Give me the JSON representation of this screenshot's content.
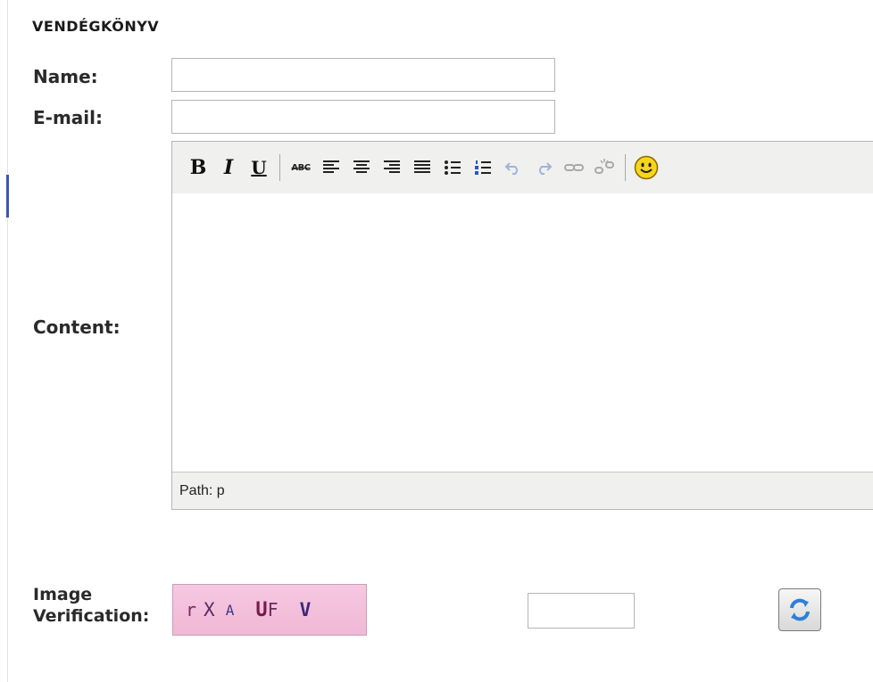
{
  "form": {
    "title": "VENDÉGKÖNYV",
    "name_label": "Name:",
    "name_value": "",
    "email_label": "E-mail:",
    "email_value": "",
    "content_label": "Content:"
  },
  "editor": {
    "toolbar": {
      "bold": "B",
      "italic": "I",
      "underline": "U",
      "spellcheck": "ABC",
      "buttons": [
        "bold",
        "italic",
        "underline",
        "spellcheck",
        "align-left",
        "align-center",
        "align-right",
        "align-justify",
        "bullet-list",
        "numbered-list",
        "undo",
        "redo",
        "link",
        "unlink",
        "emoticon"
      ],
      "disabled": [
        "undo",
        "redo",
        "link",
        "unlink"
      ]
    },
    "content": "",
    "status_path": "Path: p"
  },
  "verification": {
    "label_line1": "Image",
    "label_line2": "Verification:",
    "captcha_chars": [
      "r",
      "X",
      "A",
      "U",
      "F",
      "V"
    ],
    "input_value": ""
  },
  "colors": {
    "accent": "#3b56b0",
    "captcha_bg": "#f3bfdc",
    "refresh_icon": "#2f7fd6"
  }
}
